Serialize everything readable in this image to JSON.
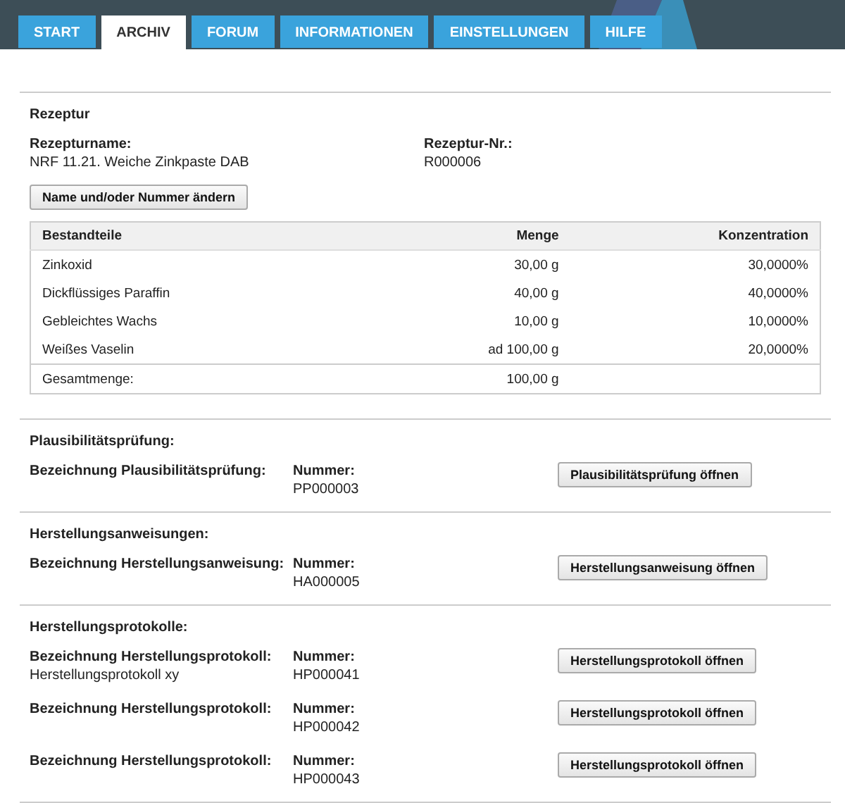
{
  "tabs": [
    {
      "label": "START",
      "selected": false
    },
    {
      "label": "ARCHIV",
      "selected": true
    },
    {
      "label": "FORUM",
      "selected": false
    },
    {
      "label": "INFORMATIONEN",
      "selected": false
    },
    {
      "label": "EINSTELLUNGEN",
      "selected": false
    },
    {
      "label": "HILFE",
      "selected": false
    }
  ],
  "recipe": {
    "title": "Rezeptur",
    "name_label": "Rezepturname:",
    "name": "NRF 11.21. Weiche Zinkpaste DAB",
    "number_label": "Rezeptur-Nr.:",
    "number": "R000006",
    "change_button": "Name und/oder Nummer ändern"
  },
  "table": {
    "columns": [
      "Bestandteile",
      "Menge",
      "Konzentration"
    ],
    "rows": [
      [
        "Zinkoxid",
        "30,00 g",
        "30,0000%"
      ],
      [
        "Dickflüssiges Paraffin",
        "40,00 g",
        "40,0000%"
      ],
      [
        "Gebleichtes Wachs",
        "10,00 g",
        "10,0000%"
      ],
      [
        "Weißes Vaselin",
        "ad 100,00 g",
        "20,0000%"
      ]
    ],
    "total": {
      "label": "Gesamtmenge:",
      "amount": "100,00 g"
    }
  },
  "sections": [
    {
      "title": "Plausibilitätsprüfung:",
      "entries": [
        {
          "label": "Bezeichnung Plausibilitätsprüfung:",
          "number_label": "Nummer:",
          "number": "PP000003",
          "button": "Plausibilitätsprüfung öffnen"
        }
      ]
    },
    {
      "title": "Herstellungsanweisungen:",
      "entries": [
        {
          "label": "Bezeichnung Herstellungsanweisung:",
          "number_label": "Nummer:",
          "number": "HA000005",
          "button": "Herstellungsanweisung öffnen"
        }
      ]
    },
    {
      "title": "Herstellungsprotokolle:",
      "entries": [
        {
          "label": "Bezeichnung Herstellungsprotokoll:",
          "value": "Herstellungsprotokoll xy",
          "number_label": "Nummer:",
          "number": "HP000041",
          "button": "Herstellungsprotokoll öffnen"
        },
        {
          "label": "Bezeichnung Herstellungsprotokoll:",
          "number_label": "Nummer:",
          "number": "HP000042",
          "button": "Herstellungsprotokoll öffnen"
        },
        {
          "label": "Bezeichnung Herstellungsprotokoll:",
          "number_label": "Nummer:",
          "number": "HP000043",
          "button": "Herstellungsprotokoll öffnen"
        }
      ]
    }
  ]
}
